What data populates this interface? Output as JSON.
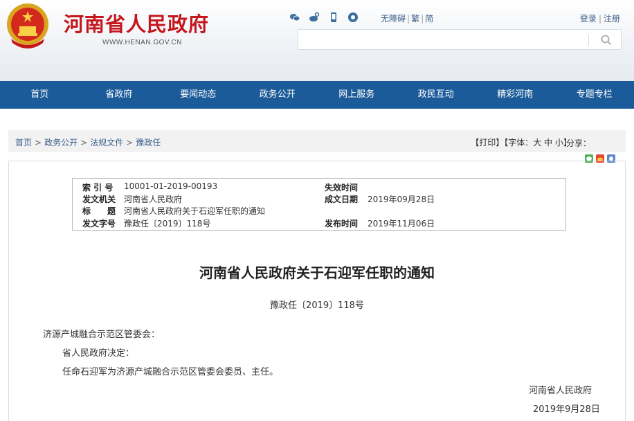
{
  "header": {
    "site_title": "河南省人民政府",
    "site_url": "WWW.HENAN.GOV.CN",
    "social_icons": [
      "wechat-icon",
      "weibo-icon",
      "mobile-icon",
      "headphone-icon"
    ],
    "accessibility": "无障碍",
    "traditional": "繁",
    "simplified": "简",
    "login": "登录",
    "register": "注册",
    "search_placeholder": ""
  },
  "nav": [
    "首页",
    "省政府",
    "要闻动态",
    "政务公开",
    "网上服务",
    "政民互动",
    "精彩河南",
    "专题专栏"
  ],
  "breadcrumb": {
    "items": [
      "首页",
      "政务公开",
      "法规文件",
      "豫政任"
    ],
    "print": "【打印】",
    "font_label": "【字体：",
    "font_large": "大",
    "font_medium": "中",
    "font_small": "小",
    "font_end": "】",
    "share": "分享："
  },
  "colors": {
    "brand_red": "#c4161c",
    "nav_blue": "#1c5b9a",
    "link_blue": "#3a5e8c"
  },
  "meta": {
    "index_label": "索 引 号",
    "index_value": "10001-01-2019-00193",
    "expire_label": "失效时间",
    "expire_value": "",
    "issuer_label": "发文机关",
    "issuer_value": "河南省人民政府",
    "created_label": "成文日期",
    "created_value": "2019年09月28日",
    "title_label": "标　　题",
    "title_value": "河南省人民政府关于石迎军任职的通知",
    "docno_label": "发文字号",
    "docno_value": "豫政任〔2019〕118号",
    "published_label": "发布时间",
    "published_value": "2019年11月06日"
  },
  "document": {
    "title": "河南省人民政府关于石迎军任职的通知",
    "number": "豫政任〔2019〕118号",
    "recipient": "济源产城融合示范区管委会：",
    "para1": "省人民政府决定：",
    "para2": "任命石迎军为济源产城融合示范区管委会委员、主任。",
    "signature": "河南省人民政府",
    "date": "2019年9月28日"
  }
}
